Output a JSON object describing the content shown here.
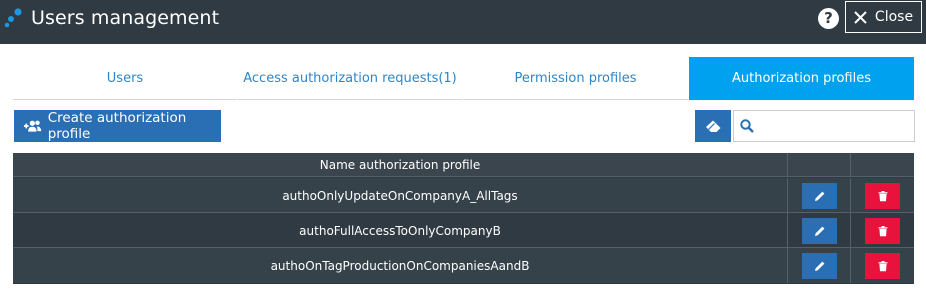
{
  "header": {
    "title": "Users management",
    "help_label": "?",
    "close_label": "Close",
    "logo_icon": "app-logo-icon",
    "background": "#2f3a42"
  },
  "tabs": [
    {
      "label": "Users",
      "active": false
    },
    {
      "label": "Access authorization requests(1)",
      "active": false
    },
    {
      "label": "Permission profiles",
      "active": false
    },
    {
      "label": "Authorization profiles",
      "active": true
    }
  ],
  "toolbar": {
    "create_label": "Create authorization profile",
    "create_icon": "add-users-icon",
    "clear_icon": "eraser-icon",
    "search_icon": "search-icon",
    "search_value": "",
    "search_placeholder": ""
  },
  "table": {
    "headers": [
      "Name authorization profile",
      "",
      ""
    ],
    "rows": [
      {
        "name": "authoOnlyUpdateOnCompanyA_AllTags"
      },
      {
        "name": "authoFullAccessToOnlyCompanyB"
      },
      {
        "name": "authoOnTagProductionOnCompaniesAandB"
      }
    ],
    "row_actions": {
      "edit_icon": "pencil-icon",
      "delete_icon": "trash-icon"
    }
  },
  "colors": {
    "accent": "#00a2f0",
    "primary_button": "#2a6fb4",
    "danger": "#e8123c",
    "tab_text": "#2e86c9",
    "table_bg": "#2f3a42"
  }
}
